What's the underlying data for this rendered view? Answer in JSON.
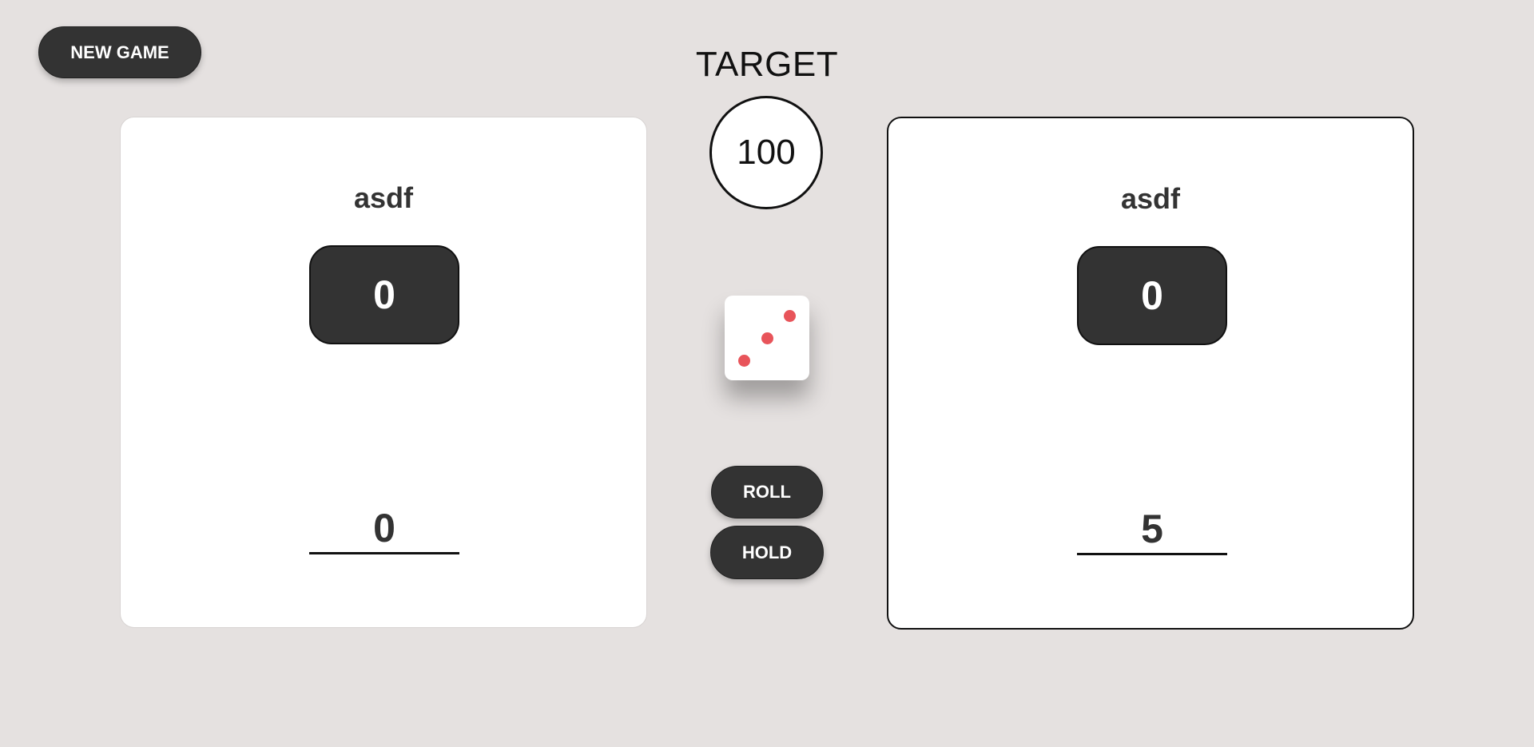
{
  "controls": {
    "new_game_label": "NEW GAME",
    "roll_label": "ROLL",
    "hold_label": "HOLD"
  },
  "target": {
    "label": "TARGET",
    "value": "100"
  },
  "dice": {
    "value": 3,
    "pip_color": "#e8545a"
  },
  "players": [
    {
      "name": "asdf",
      "total_score": "0",
      "current_score": "0",
      "active": false
    },
    {
      "name": "asdf",
      "total_score": "0",
      "current_score": "5",
      "active": true
    }
  ],
  "colors": {
    "background": "#e5e1e0",
    "button": "#333333",
    "card": "#ffffff"
  }
}
